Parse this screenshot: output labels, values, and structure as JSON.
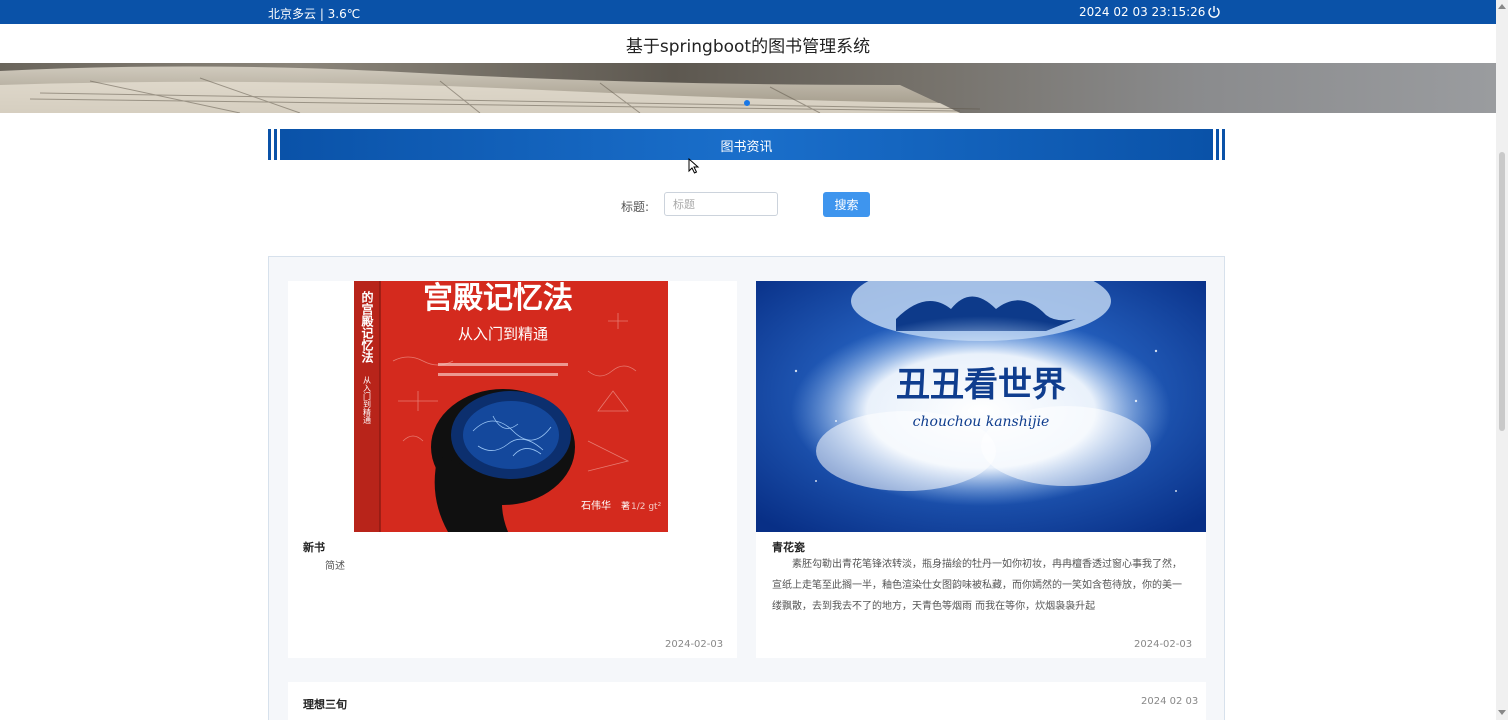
{
  "topbar": {
    "weather": "北京多云 |  3.6℃",
    "datetime": "2024 02 03   23:15:26",
    "color": "#0a52a8"
  },
  "header": {
    "title": "基于springboot的图书管理系统"
  },
  "section": {
    "title": "图书资讯"
  },
  "search": {
    "label": "标题:",
    "placeholder": "标题",
    "button_label": "搜索"
  },
  "news": [
    {
      "title": "新书",
      "description": "简述",
      "date": "2024-02-03",
      "cover": {
        "headline": "宫殿记忆法",
        "subtitle": "从入门到精通",
        "spine": "的宫殿记忆法",
        "spine_sub": "从入门到精通",
        "author": "石伟华",
        "author_note": "著",
        "formula": "1/2 gt²",
        "background": "#d42a1e"
      }
    },
    {
      "title": "青花瓷",
      "description": "素胚勾勒出青花笔锋浓转淡，瓶身描绘的牡丹一如你初妆，冉冉檀香透过窗心事我了然，宣纸上走笔至此搁一半，釉色渲染仕女图韵味被私藏，而你嫣然的一笑如含苞待放，你的美一缕飘散，去到我去不了的地方，天青色等烟雨 而我在等你，炊烟袅袅升起",
      "date": "2024-02-03",
      "cover": {
        "headline": "丑丑看世界",
        "subtitle": "chouchou kanshijie",
        "background": "#0b3f9c"
      }
    },
    {
      "title": "理想三旬",
      "description": "",
      "date": "2024 02 03"
    }
  ]
}
